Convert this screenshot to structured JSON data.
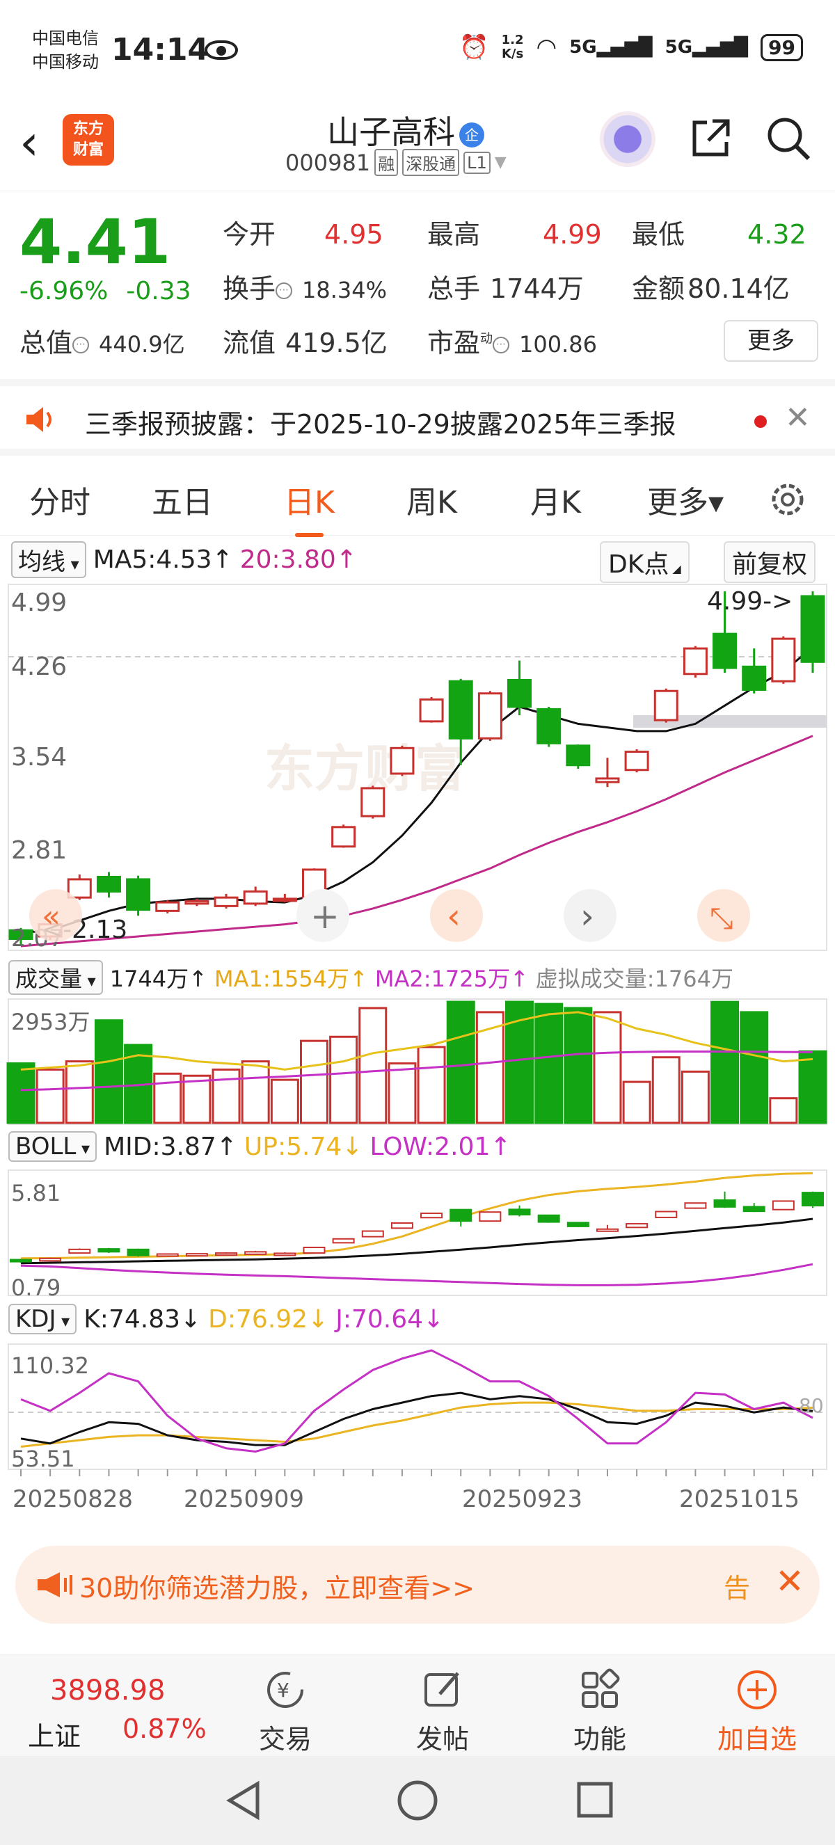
{
  "status_bar": {
    "carrier1": "中国电信",
    "carrier2": "中国移动",
    "time": "14:14",
    "net_speed_top": "1.2",
    "net_speed_bottom": "K/s",
    "sig1": "5G",
    "sig2": "5G",
    "battery": "99"
  },
  "header": {
    "logo_line1": "东方",
    "logo_line2": "财富",
    "stock_name": "山子高科",
    "qi_badge": "企",
    "code": "000981",
    "tag1": "融",
    "tag2": "深股通",
    "tag3": "L1"
  },
  "quote": {
    "price": "4.41",
    "change_pct": "-6.96%",
    "change_amt": "-0.33",
    "open_label": "今开",
    "open": "4.95",
    "high_label": "最高",
    "high": "4.99",
    "low_label": "最低",
    "low": "4.32",
    "turnover_label": "换手",
    "turnover": "18.34%",
    "volume_label": "总手",
    "volume": "1744万",
    "amount_label": "金额",
    "amount": "80.14亿",
    "mktcap_label": "总值",
    "mktcap": "440.9亿",
    "float_label": "流值",
    "float": "419.5亿",
    "pe_label": "市盈",
    "pe_sup": "动",
    "pe": "100.86",
    "more": "更多"
  },
  "notice": {
    "text": "三季报预披露：于2025-10-29披露2025年三季报",
    "close": "✕"
  },
  "tabs": [
    "分时",
    "五日",
    "日K",
    "周K",
    "月K",
    "更多▾"
  ],
  "kline": {
    "ma_selector": "均线",
    "ma5": "MA5:4.53↑",
    "ma20": "20:3.80↑",
    "dk_button": "DK点",
    "fq_button": "前复权",
    "y_labels": [
      "4.99",
      "4.26",
      "3.54",
      "2.81",
      "2.07"
    ],
    "high_annot": "4.99->",
    "low_annot": "<-2.13",
    "watermark": "东方财富"
  },
  "volume": {
    "selector": "成交量",
    "total": "1744万↑",
    "ma1": "MA1:1554万↑",
    "ma2": "MA2:1725万↑",
    "virtual": "虚拟成交量:1764万",
    "y_label": "2953万"
  },
  "boll": {
    "selector": "BOLL",
    "mid": "MID:3.87↑",
    "up": "UP:5.74↓",
    "low": "LOW:2.01↑",
    "y_top": "5.81",
    "y_bottom": "0.79"
  },
  "kdj": {
    "selector": "KDJ",
    "k": "K:74.83↓",
    "d": "D:76.92↓",
    "j": "J:70.64↓",
    "y_top": "110.32",
    "y_bottom": "53.51",
    "ref": "80"
  },
  "x_dates": [
    "20250828",
    "20250909",
    "20250923",
    "20251015"
  ],
  "chart_data": {
    "type": "candlestick",
    "candles": [
      {
        "o": 2.2,
        "c": 2.13,
        "h": 2.22,
        "l": 2.07,
        "up": false
      },
      {
        "o": 2.15,
        "c": 2.25,
        "h": 2.28,
        "l": 2.12,
        "up": true
      },
      {
        "o": 2.47,
        "c": 2.62,
        "h": 2.66,
        "l": 2.45,
        "up": true
      },
      {
        "o": 2.64,
        "c": 2.52,
        "h": 2.68,
        "l": 2.47,
        "up": false
      },
      {
        "o": 2.62,
        "c": 2.37,
        "h": 2.65,
        "l": 2.32,
        "up": false
      },
      {
        "o": 2.36,
        "c": 2.43,
        "h": 2.45,
        "l": 2.34,
        "up": true
      },
      {
        "o": 2.42,
        "c": 2.44,
        "h": 2.46,
        "l": 2.4,
        "up": true
      },
      {
        "o": 2.4,
        "c": 2.47,
        "h": 2.5,
        "l": 2.38,
        "up": true
      },
      {
        "o": 2.42,
        "c": 2.52,
        "h": 2.56,
        "l": 2.4,
        "up": true
      },
      {
        "o": 2.45,
        "c": 2.46,
        "h": 2.5,
        "l": 2.43,
        "up": true
      },
      {
        "o": 2.47,
        "c": 2.7,
        "h": 2.71,
        "l": 2.46,
        "up": true
      },
      {
        "o": 2.89,
        "c": 3.05,
        "h": 3.07,
        "l": 2.88,
        "up": true
      },
      {
        "o": 3.14,
        "c": 3.37,
        "h": 3.39,
        "l": 3.12,
        "up": true
      },
      {
        "o": 3.49,
        "c": 3.7,
        "h": 3.72,
        "l": 3.47,
        "up": true
      },
      {
        "o": 3.92,
        "c": 4.1,
        "h": 4.12,
        "l": 3.91,
        "up": true
      },
      {
        "o": 4.25,
        "c": 3.78,
        "h": 4.27,
        "l": 3.56,
        "up": false
      },
      {
        "o": 3.78,
        "c": 4.15,
        "h": 4.17,
        "l": 3.76,
        "up": true
      },
      {
        "o": 4.26,
        "c": 4.04,
        "h": 4.42,
        "l": 3.97,
        "up": false
      },
      {
        "o": 4.02,
        "c": 3.74,
        "h": 4.04,
        "l": 3.71,
        "up": false
      },
      {
        "o": 3.72,
        "c": 3.56,
        "h": 3.73,
        "l": 3.53,
        "up": false
      },
      {
        "o": 3.42,
        "c": 3.45,
        "h": 3.62,
        "l": 3.38,
        "up": true
      },
      {
        "o": 3.52,
        "c": 3.67,
        "h": 3.69,
        "l": 3.5,
        "up": true
      },
      {
        "o": 3.93,
        "c": 4.17,
        "h": 4.19,
        "l": 3.91,
        "up": true
      },
      {
        "o": 4.31,
        "c": 4.52,
        "h": 4.54,
        "l": 4.28,
        "up": true
      },
      {
        "o": 4.64,
        "c": 4.36,
        "h": 4.99,
        "l": 4.32,
        "up": false
      },
      {
        "o": 4.37,
        "c": 4.18,
        "h": 4.52,
        "l": 4.15,
        "up": false
      },
      {
        "o": 4.25,
        "c": 4.6,
        "h": 4.62,
        "l": 4.23,
        "up": true
      },
      {
        "o": 4.95,
        "c": 4.41,
        "h": 4.99,
        "l": 4.32,
        "up": false
      }
    ],
    "ma5": [
      2.18,
      2.2,
      2.28,
      2.36,
      2.42,
      2.44,
      2.46,
      2.46,
      2.44,
      2.43,
      2.49,
      2.6,
      2.76,
      2.98,
      3.25,
      3.58,
      3.85,
      4.04,
      3.97,
      3.9,
      3.87,
      3.84,
      3.84,
      3.9,
      4.05,
      4.2,
      4.33,
      4.53
    ],
    "ma20": [
      2.07,
      2.09,
      2.11,
      2.13,
      2.15,
      2.17,
      2.19,
      2.21,
      2.23,
      2.25,
      2.28,
      2.32,
      2.38,
      2.45,
      2.53,
      2.62,
      2.71,
      2.82,
      2.92,
      3.01,
      3.09,
      3.18,
      3.28,
      3.39,
      3.5,
      3.6,
      3.7,
      3.8
    ],
    "volume": [
      1450,
      1300,
      1500,
      2500,
      1900,
      1200,
      1150,
      1300,
      1500,
      1050,
      2000,
      2100,
      2800,
      1450,
      1850,
      2953,
      2700,
      2953,
      2900,
      2800,
      2700,
      1000,
      1600,
      1250,
      2950,
      2700,
      600,
      1744
    ],
    "vol_ma1": [
      1300,
      1350,
      1400,
      1500,
      1650,
      1600,
      1500,
      1450,
      1400,
      1300,
      1400,
      1500,
      1700,
      1800,
      1900,
      2100,
      2300,
      2500,
      2650,
      2700,
      2550,
      2300,
      2150,
      1950,
      1800,
      1650,
      1500,
      1554
    ],
    "vol_ma2": [
      800,
      820,
      850,
      880,
      920,
      980,
      1020,
      1060,
      1100,
      1130,
      1170,
      1210,
      1260,
      1300,
      1350,
      1400,
      1470,
      1540,
      1610,
      1680,
      1710,
      1730,
      1740,
      1740,
      1740,
      1735,
      1730,
      1725
    ],
    "boll_up": [
      2.25,
      2.26,
      2.28,
      2.3,
      2.32,
      2.34,
      2.36,
      2.38,
      2.4,
      2.42,
      2.48,
      2.62,
      2.85,
      3.15,
      3.55,
      3.95,
      4.3,
      4.62,
      4.85,
      5.0,
      5.1,
      5.18,
      5.28,
      5.4,
      5.55,
      5.65,
      5.72,
      5.74
    ],
    "boll_mid": [
      2.05,
      2.07,
      2.09,
      2.11,
      2.13,
      2.15,
      2.17,
      2.19,
      2.21,
      2.24,
      2.27,
      2.31,
      2.37,
      2.44,
      2.52,
      2.61,
      2.7,
      2.81,
      2.91,
      3.0,
      3.08,
      3.17,
      3.27,
      3.38,
      3.49,
      3.6,
      3.72,
      3.87
    ],
    "boll_low": [
      1.95,
      1.92,
      1.85,
      1.78,
      1.72,
      1.67,
      1.62,
      1.58,
      1.55,
      1.52,
      1.48,
      1.44,
      1.4,
      1.36,
      1.32,
      1.28,
      1.24,
      1.2,
      1.17,
      1.15,
      1.15,
      1.17,
      1.22,
      1.3,
      1.42,
      1.58,
      1.78,
      2.01
    ],
    "kdj_k": [
      58,
      55,
      62,
      68,
      67,
      60,
      57,
      56,
      54,
      54,
      62,
      70,
      76,
      80,
      84,
      86,
      82,
      84,
      82,
      76,
      68,
      67,
      72,
      80,
      78,
      74,
      77,
      74.83
    ],
    "kdj_d": [
      53,
      55,
      57,
      59,
      60,
      60,
      59,
      58,
      57,
      56,
      58,
      62,
      66,
      69,
      73,
      77,
      79,
      80,
      80,
      79,
      77,
      75,
      75,
      76,
      76,
      76,
      76,
      76.92
    ],
    "kdj_j": [
      82,
      75,
      86,
      98,
      93,
      72,
      58,
      52,
      50,
      55,
      75,
      88,
      100,
      107,
      112,
      103,
      93,
      93,
      84,
      70,
      55,
      55,
      68,
      86,
      85,
      76,
      80,
      70.64
    ]
  },
  "chart_overlay": {
    "btn_first": "«",
    "btn_prev": "‹",
    "btn_next": "›",
    "btn_zoom": "⤡",
    "crosshair": "+"
  },
  "banner": {
    "text": "30助你筛选潜力股，立即查看>>",
    "tag": "告",
    "close": "✕"
  },
  "bottom_nav": {
    "index_value": "3898.98",
    "index_name": "上证",
    "index_pct": "0.87%",
    "items": [
      "交易",
      "发帖",
      "功能",
      "加自选"
    ]
  },
  "colors": {
    "up": "#c8322e",
    "down": "#13a413",
    "accent": "#f35b1c",
    "ma5": "#111111",
    "ma20": "#c02a8a",
    "boll_up": "#eab422",
    "boll_low": "#c530c5"
  }
}
